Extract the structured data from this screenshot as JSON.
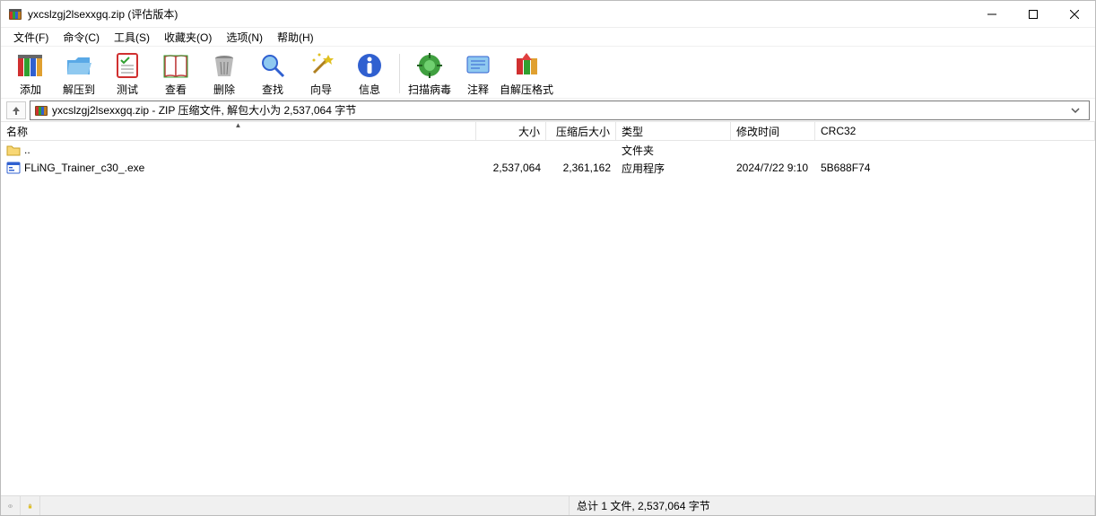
{
  "window": {
    "title": "yxcslzgj2lsexxgq.zip (评估版本)"
  },
  "menu": {
    "file": "文件(F)",
    "command": "命令(C)",
    "tools": "工具(S)",
    "favorites": "收藏夹(O)",
    "options": "选项(N)",
    "help": "帮助(H)"
  },
  "toolbar": {
    "add": "添加",
    "extract": "解压到",
    "test": "测试",
    "view": "查看",
    "delete": "删除",
    "find": "查找",
    "wizard": "向导",
    "info": "信息",
    "scan": "扫描病毒",
    "comment": "注释",
    "sfx": "自解压格式"
  },
  "address": {
    "text": "yxcslzgj2lsexxgq.zip - ZIP 压缩文件, 解包大小为 2,537,064 字节"
  },
  "columns": {
    "name": "名称",
    "size": "大小",
    "packed": "压缩后大小",
    "type": "类型",
    "modified": "修改时间",
    "crc": "CRC32"
  },
  "rows": {
    "up": {
      "name": "..",
      "type": "文件夹"
    },
    "r1": {
      "name": "FLiNG_Trainer_c30_.exe",
      "size": "2,537,064",
      "packed": "2,361,162",
      "type": "应用程序",
      "modified": "2024/7/22 9:10",
      "crc": "5B688F74"
    }
  },
  "status": {
    "sel": "",
    "total": "总计 1 文件, 2,537,064 字节"
  }
}
